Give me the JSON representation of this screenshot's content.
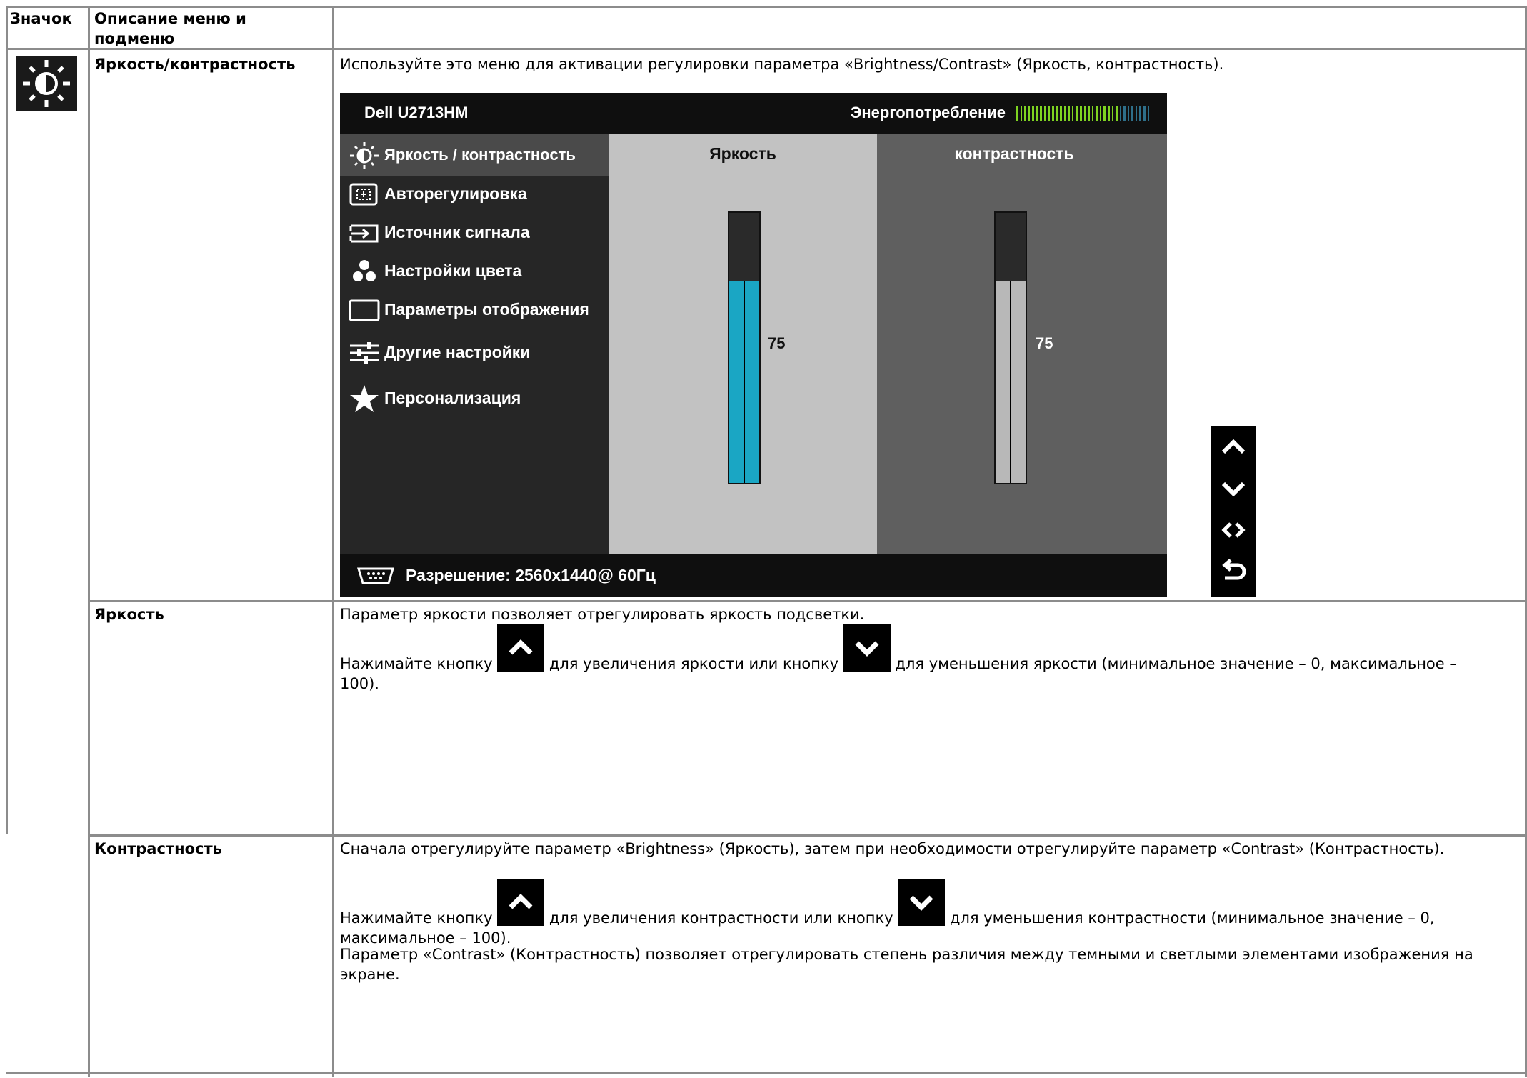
{
  "table": {
    "headers": {
      "icon": "Значок",
      "description": "Описание меню и подменю"
    },
    "rows": [
      {
        "name": "Яркость/контрастность",
        "text": "Используйте это меню для активации регулировки параметра «Brightness/Contrast» (Яркость, контрастность)."
      },
      {
        "name": "Яркость",
        "line1": "Параметр яркости позволяет отрегулировать яркость подсветки.",
        "before_up": "Нажимайте кнопку",
        "between": "для увеличения яркости или кнопку",
        "after_down": "для уменьшения яркости (минимальное значение – 0, максимальное – 100)."
      },
      {
        "name": "Контрастность",
        "line1": "Сначала отрегулируйте параметр «Brightness» (Яркость), затем при необходимости отрегулируйте параметр «Contrast» (Контрастность).",
        "before_up": "Нажимайте кнопку",
        "between": "для увеличения контрастности или кнопку",
        "after_down": "для уменьшения контрастности (минимальное значение – 0, максимальное – 100).",
        "line3": "Параметр «Contrast» (Контрастность) позволяет отрегулировать степень различия между темными и светлыми элементами изображения на экране."
      }
    ]
  },
  "osd": {
    "model": "Dell U2713HM",
    "energy_label": "Энергопотребление",
    "energy_level": 0.76,
    "menu": [
      {
        "icon": "brightness-icon",
        "label": "Яркость / контрастность",
        "selected": true
      },
      {
        "icon": "auto-adjust-icon",
        "label": "Авторегулировка"
      },
      {
        "icon": "input-source-icon",
        "label": "Источник сигнала"
      },
      {
        "icon": "color-settings-icon",
        "label": "Настройки цвета"
      },
      {
        "icon": "display-settings-icon",
        "label": "Параметры отображения"
      },
      {
        "icon": "other-settings-icon",
        "label": "Другие настройки"
      },
      {
        "icon": "star-icon",
        "label": "Персонализация"
      }
    ],
    "brightness": {
      "label": "Яркость",
      "value": 75
    },
    "contrast": {
      "label": "контрастность",
      "value": 75
    },
    "resolution": "Разрешение: 2560x1440@ 60Гц"
  },
  "nav_buttons": [
    "chevron-up-icon",
    "chevron-down-icon",
    "left-right-icon",
    "back-icon"
  ],
  "colors": {
    "brightness_fill": "#1aa6c4",
    "contrast_fill": "#b8b8b8",
    "energy_on": "#7ed321",
    "energy_off": "#2e6f8a"
  }
}
